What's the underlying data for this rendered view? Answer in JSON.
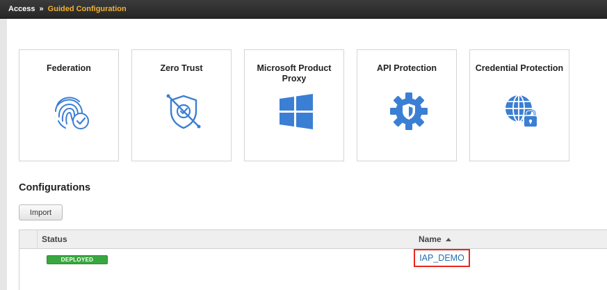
{
  "breadcrumb": {
    "root": "Access",
    "separator": "»",
    "current": "Guided Configuration"
  },
  "tiles": [
    {
      "label": "Federation",
      "icon": "fingerprint-check-icon"
    },
    {
      "label": "Zero Trust",
      "icon": "shield-check-icon"
    },
    {
      "label": "Microsoft Product Proxy",
      "icon": "windows-logo-icon"
    },
    {
      "label": "API Protection",
      "icon": "gear-shield-icon"
    },
    {
      "label": "Credential Protection",
      "icon": "globe-lock-icon"
    }
  ],
  "configurations": {
    "title": "Configurations",
    "import_label": "Import",
    "columns": {
      "status": "Status",
      "name": "Name"
    },
    "rows": [
      {
        "status": "DEPLOYED",
        "name": "IAP_DEMO"
      }
    ]
  },
  "colors": {
    "accent_blue": "#3b7fd4",
    "breadcrumb_current": "#f2b233",
    "deployed_green": "#39a73f",
    "highlight_red": "#e8261e",
    "link_blue": "#1f6fb3"
  }
}
